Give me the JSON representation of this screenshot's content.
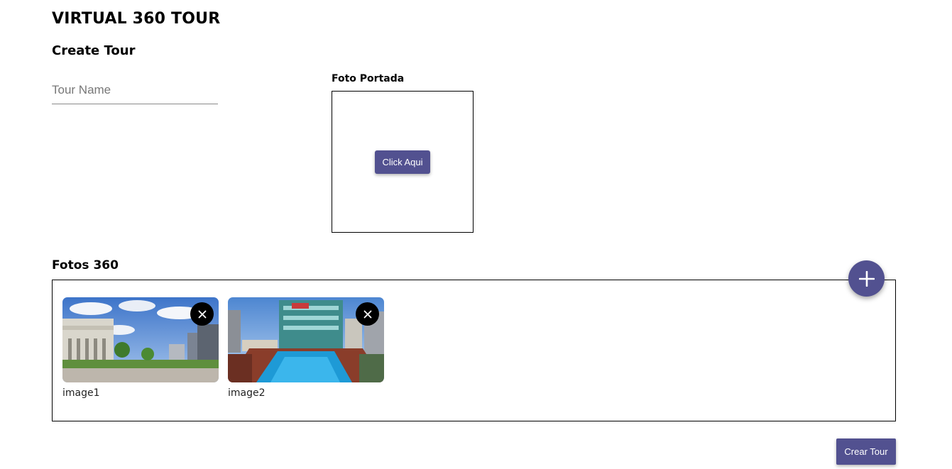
{
  "app": {
    "title": "VIRTUAL 360 TOUR"
  },
  "form": {
    "section_title": "Create Tour",
    "tour_name": {
      "placeholder": "Tour Name",
      "value": ""
    },
    "cover": {
      "label": "Foto Portada",
      "button_label": "Click Aqui"
    },
    "photos": {
      "label": "Fotos 360",
      "items": [
        {
          "caption": "image1",
          "remove_icon": "close-icon"
        },
        {
          "caption": "image2",
          "remove_icon": "close-icon"
        }
      ]
    },
    "add_icon": "plus-icon",
    "submit_label": "Crear Tour"
  },
  "colors": {
    "accent": "#525190",
    "border": "#000000",
    "remove_button": "#000000"
  }
}
